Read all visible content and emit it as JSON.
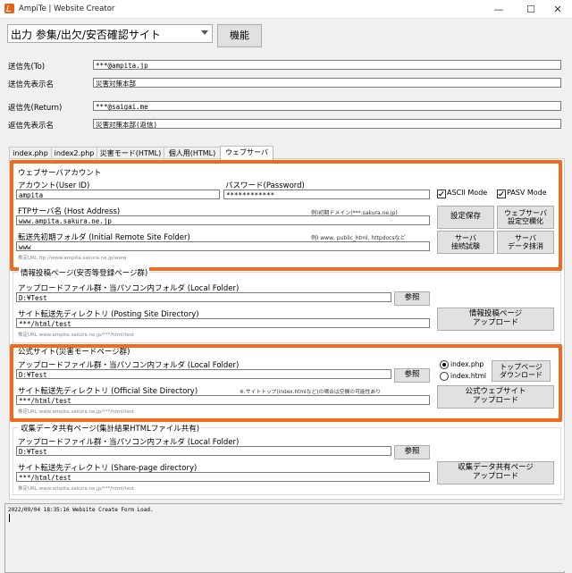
{
  "window": {
    "title": "AmpiTe | Website Creator",
    "minimize": "—",
    "maximize": "☐",
    "close": "✕"
  },
  "toolbar": {
    "mode_select": "出力 参集/出欠/安否確認サイト",
    "function_button": "機能"
  },
  "mail": {
    "to_label": "送信先(To)",
    "to_value": "***@ampita.jp",
    "to_display_label": "送信先表示名",
    "to_display_value": "災害対策本部",
    "return_label": "返信先(Return)",
    "return_value": "***@saigai.me",
    "return_display_label": "返信先表示名",
    "return_display_value": "災害対策本部(返信)"
  },
  "tabs": [
    "index.php",
    "index2.php",
    "災害モード(HTML)",
    "個人用(HTML)",
    "ウェブサーバ"
  ],
  "account": {
    "group_title": "ウェブサーバアカウント",
    "account_label": "アカウント(User ID)",
    "account_value": "ampita",
    "password_label": "パスワード(Password)",
    "password_value": "************",
    "ascii_label": "ASCII Mode",
    "pasv_label": "PASV Mode",
    "ftp_label": "FTPサーバ名 (Host Address)",
    "ftp_hint": "例)初期ドメイン(***.sakura.ne.jp)",
    "ftp_value": "www.ampita.sakura.ne.jp",
    "folder_label": "転送先初期フォルダ (Initial Remote Site Folder)",
    "folder_hint": "例) www, public_html, httpdocsなど",
    "folder_value": "www",
    "url_hint": "推定URL  ftp://www.ampita.sakura.ne.jp/www",
    "save_button": "設定保存",
    "clear_button_1": "ウェブサーバ",
    "clear_button_2": "設定空欄化",
    "test_button_1": "サーバ",
    "test_button_2": "接続試験",
    "delete_button_1": "サーバ",
    "delete_button_2": "データ抹消"
  },
  "posting": {
    "group_title": "情報投稿ページ(安否等登録ページ群)",
    "local_label": "アップロードファイル群・当パソコン内フォルダ (Local Folder)",
    "local_value": "D:¥Test",
    "browse": "参照",
    "site_label": "サイト転送先ディレクトリ (Posting Site Directory)",
    "site_value": "***/html/test",
    "url_hint": "推定URL  www.ampita.sakura.ne.jp/***/html/test",
    "upload_1": "情報投稿ページ",
    "upload_2": "アップロード"
  },
  "official": {
    "group_title": "公式サイト(災害モードページ群)",
    "local_label": "アップロードファイル群・当パソコン内フォルダ (Local Folder)",
    "local_value": "D:¥Test",
    "browse": "参照",
    "radio_php": "index.php",
    "radio_html": "index.html",
    "download_1": "トップページ",
    "download_2": "ダウンロード",
    "site_label": "サイト転送先ディレクトリ (Official Site Directory)",
    "site_note": "※.サイトトップ(index.htmlなど)の場合は空欄の可能性あり",
    "site_value": "***/html/test",
    "url_hint": "推定URL  www.ampita.sakura.ne.jp/***/html/test",
    "upload_1": "公式ウェブサイト",
    "upload_2": "アップロード"
  },
  "share": {
    "group_title": "収集データ共有ページ(集計結果HTMLファイル共有)",
    "local_label": "アップロードファイル群・当パソコン内フォルダ (Local Folder)",
    "local_value": "D:¥Test",
    "browse": "参照",
    "site_label": "サイト転送先ディレクトリ (Share-page directory)",
    "site_value": "***/html/test",
    "url_hint": "推定URL  www.ampita.sakura.ne.jp/***/html/test",
    "upload_1": "収集データ共有ページ",
    "upload_2": "アップロード"
  },
  "log": {
    "line": "2022/09/04 18:35:16 Website Create Form Load."
  },
  "colors": {
    "highlight": "#f26a1b",
    "app_icon": "#e8601c"
  }
}
